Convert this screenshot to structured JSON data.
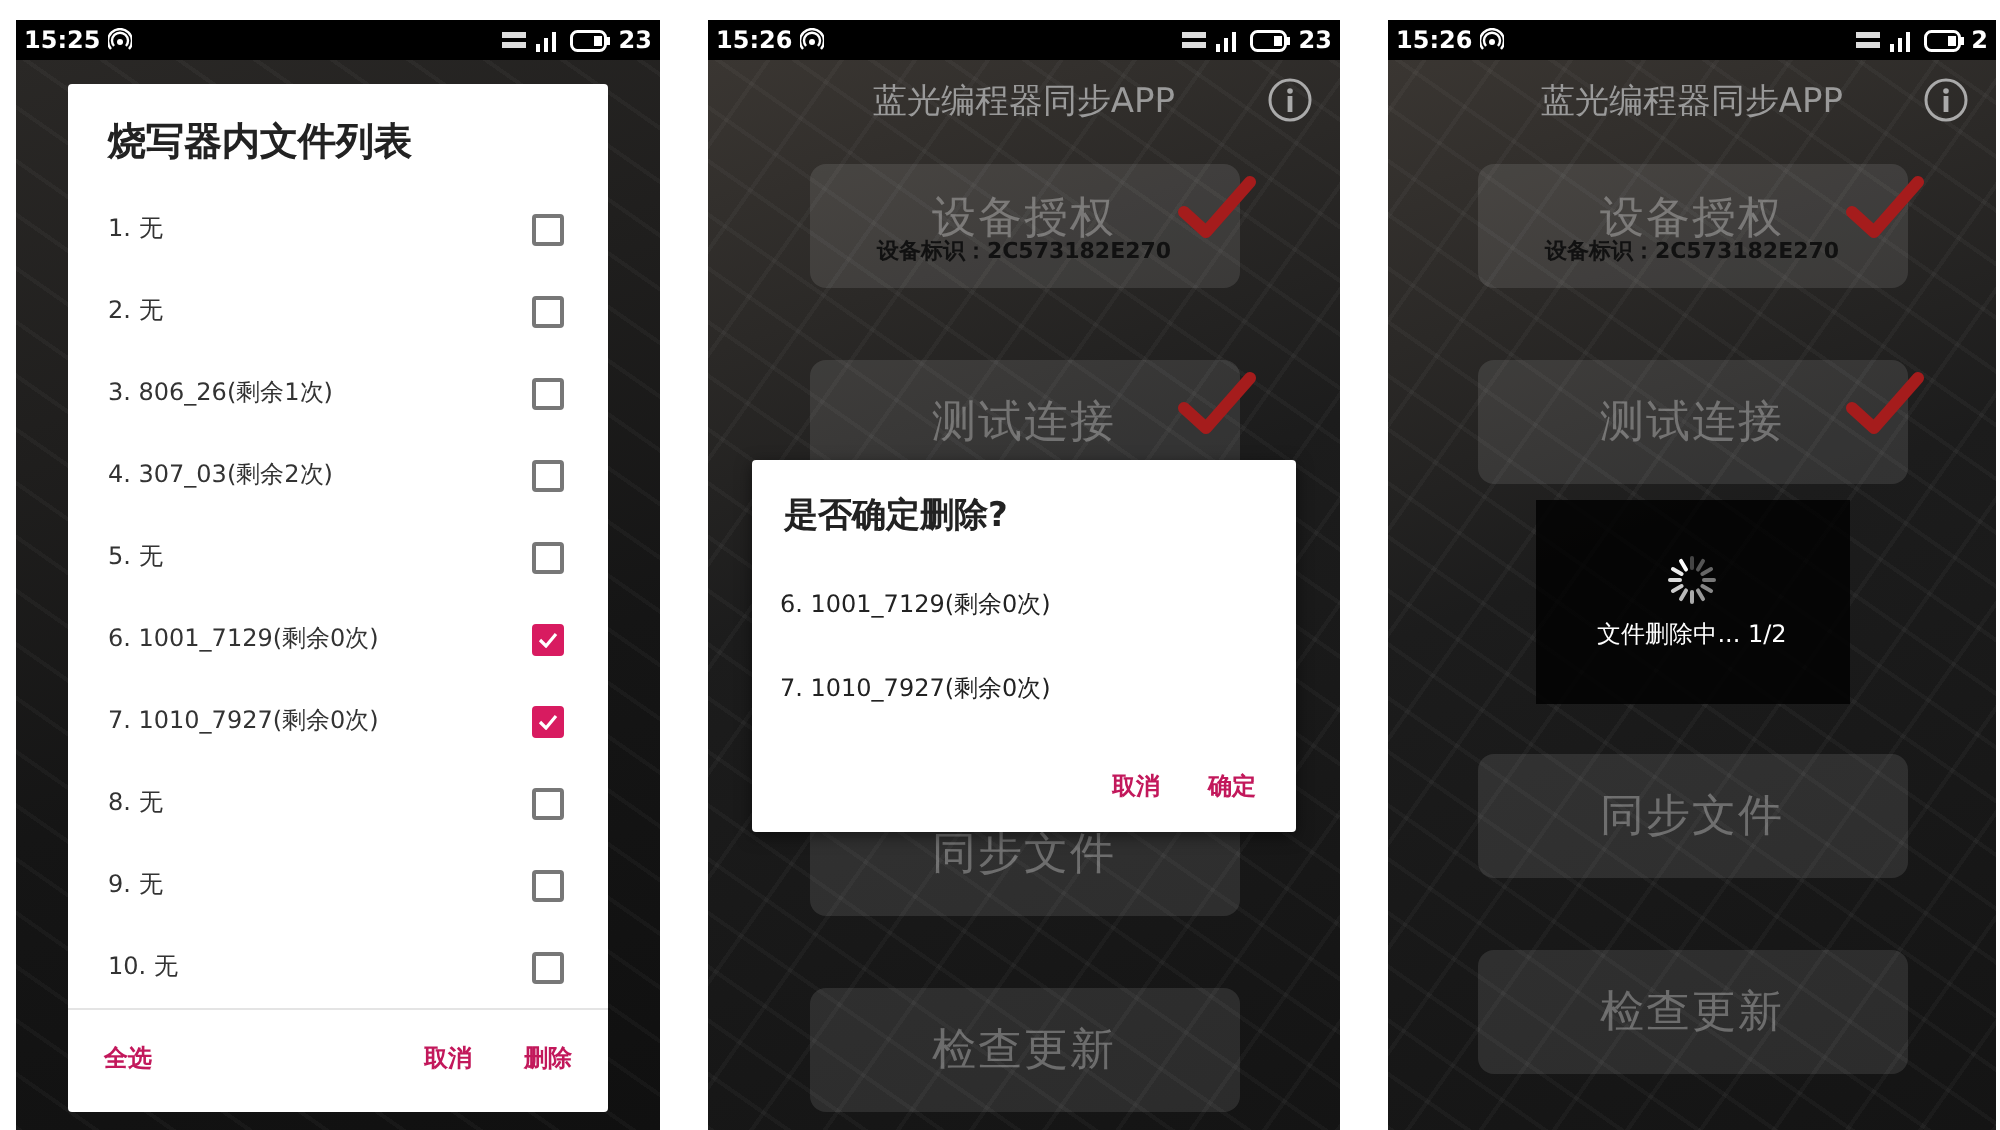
{
  "phones": [
    {
      "status_bar": {
        "time": "15:25",
        "battery": "23"
      },
      "body": [
        {
          "kind": "file_list_dialog",
          "title": "烧写器内文件列表",
          "files": [
            {
              "label": "1. 无",
              "checked": false
            },
            {
              "label": "2. 无",
              "checked": false
            },
            {
              "label": "3. 806_26(剩余1次)",
              "checked": false
            },
            {
              "label": "4. 307_03(剩余2次)",
              "checked": false
            },
            {
              "label": "5. 无",
              "checked": false
            },
            {
              "label": "6. 1001_7129(剩余0次)",
              "checked": true
            },
            {
              "label": "7. 1010_7927(剩余0次)",
              "checked": true
            },
            {
              "label": "8. 无",
              "checked": false
            },
            {
              "label": "9. 无",
              "checked": false
            },
            {
              "label": "10. 无",
              "checked": false
            }
          ],
          "left_button": "全选",
          "buttons": [
            "取消",
            "删除"
          ]
        }
      ]
    },
    {
      "status_bar": {
        "time": "15:26",
        "battery": "23"
      },
      "title": "蓝光编程器同步APP",
      "body": [
        {
          "kind": "menu_button",
          "label": "设备授权",
          "done": true,
          "note": "设备标识：2C573182E270"
        },
        {
          "kind": "menu_button",
          "label": "测试连接",
          "done": true
        },
        {
          "kind": "confirm_dialog",
          "title": "是否确定删除?",
          "items": [
            "6. 1001_7129(剩余0次)",
            "7. 1010_7927(剩余0次)"
          ],
          "buttons": [
            "取消",
            "确定"
          ]
        },
        {
          "kind": "menu_button",
          "label": "同步文件",
          "done": false
        },
        {
          "kind": "menu_button",
          "label": "检查更新",
          "done": false
        }
      ]
    },
    {
      "status_bar": {
        "time": "15:26",
        "battery": "2"
      },
      "title": "蓝光编程器同步APP",
      "body": [
        {
          "kind": "menu_button",
          "label": "设备授权",
          "done": true,
          "note": "设备标识：2C573182E270"
        },
        {
          "kind": "menu_button",
          "label": "测试连接",
          "done": true
        },
        {
          "kind": "progress",
          "text": "文件删除中... 1/2"
        },
        {
          "kind": "menu_button",
          "label": "同步文件",
          "done": false
        },
        {
          "kind": "menu_button",
          "label": "检查更新",
          "done": false
        }
      ]
    }
  ]
}
